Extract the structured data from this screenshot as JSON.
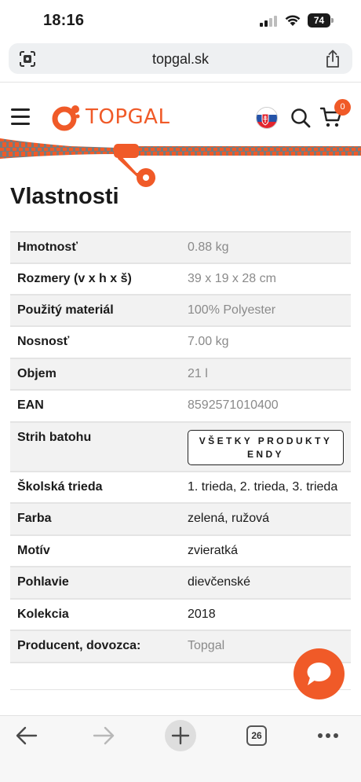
{
  "status_bar": {
    "time": "18:16",
    "battery": "74"
  },
  "browser": {
    "url": "topgal.sk",
    "tab_count": "26"
  },
  "header": {
    "logo_text": "TOPGAL",
    "cart_count": "0"
  },
  "page_title": "Vlastnosti",
  "properties": [
    {
      "key": "Hmotnosť",
      "value": "0.88 kg"
    },
    {
      "key": "Rozmery (v x h x š)",
      "value": "39 x 19 x 28 cm"
    },
    {
      "key": "Použitý materiál",
      "value": "100% Polyester"
    },
    {
      "key": "Nosnosť",
      "value": "7.00 kg"
    },
    {
      "key": "Objem",
      "value": "21 l"
    },
    {
      "key": "EAN",
      "value": "8592571010400"
    },
    {
      "key": "Strih batohu",
      "value": "VŠETKY PRODUKTY ENDY"
    },
    {
      "key": "Školská trieda",
      "value": "1. trieda, 2. trieda, 3. trieda"
    },
    {
      "key": "Farba",
      "value": "zelená, ružová"
    },
    {
      "key": "Motív",
      "value": "zvieratká"
    },
    {
      "key": "Pohlavie",
      "value": "dievčenské"
    },
    {
      "key": "Kolekcia",
      "value": "2018"
    },
    {
      "key": "Producent, dovozca:",
      "value": "Topgal"
    }
  ],
  "colors": {
    "brand": "#f05a28",
    "row_shade": "#f2f2f2",
    "muted_text": "#8a8a8a"
  },
  "icons": [
    "signal-icon",
    "wifi-icon",
    "battery-icon",
    "screen-mirror-icon",
    "share-icon",
    "menu-icon",
    "slovak-flag-icon",
    "search-icon",
    "cart-icon",
    "chat-icon",
    "back-arrow-icon",
    "forward-arrow-icon",
    "plus-icon",
    "tabs-icon",
    "more-icon"
  ]
}
